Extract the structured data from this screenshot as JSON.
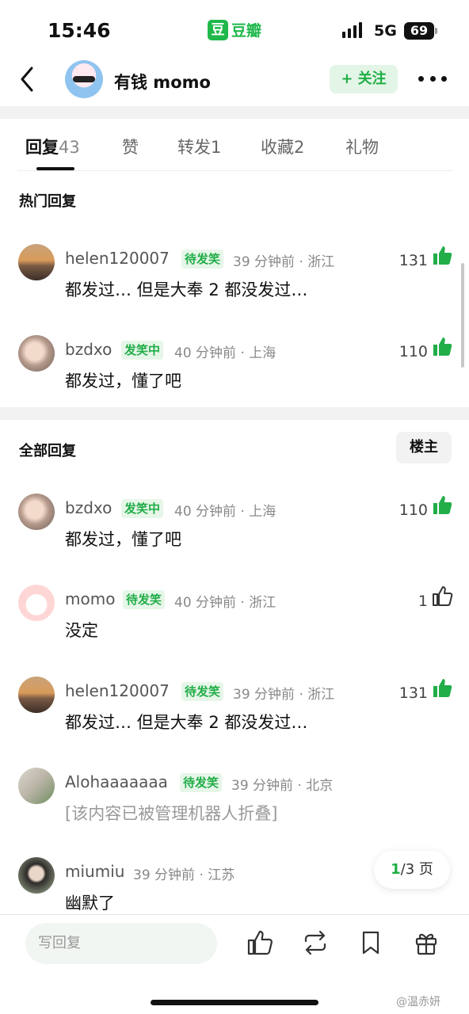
{
  "status_bar": {
    "time": "15:46",
    "app_icon_char": "豆",
    "app_name": "豆瓣",
    "network": "5G",
    "battery": "69"
  },
  "header": {
    "username": "有钱 momo",
    "follow_label": "+ 关注"
  },
  "tabs": [
    {
      "label": "回复",
      "count": "43",
      "active": true
    },
    {
      "label": "赞",
      "count": ""
    },
    {
      "label": "转发",
      "count": "1"
    },
    {
      "label": "收藏",
      "count": "2"
    },
    {
      "label": "礼物",
      "count": ""
    }
  ],
  "hot_section": {
    "title": "热门回复",
    "comments": [
      {
        "user": "helen120007",
        "badge": "待发笑",
        "meta": "39 分钟前 · 浙江",
        "text": "都发过… 但是大奉 2 都没发过…",
        "likes": "131",
        "liked": true
      },
      {
        "user": "bzdxo",
        "badge": "发笑中",
        "meta": "40 分钟前 · 上海",
        "text": "都发过，懂了吧",
        "likes": "110",
        "liked": true
      }
    ]
  },
  "all_section": {
    "title": "全部回复",
    "owner_filter": "楼主",
    "comments": [
      {
        "user": "bzdxo",
        "badge": "发笑中",
        "meta": "40 分钟前 · 上海",
        "text": "都发过，懂了吧",
        "likes": "110",
        "liked": true
      },
      {
        "user": "momo",
        "badge": "待发笑",
        "meta": "40 分钟前 · 浙江",
        "text": "没定",
        "likes": "1",
        "liked": false
      },
      {
        "user": "helen120007",
        "badge": "待发笑",
        "meta": "39 分钟前 · 浙江",
        "text": "都发过… 但是大奉 2 都没发过…",
        "likes": "131",
        "liked": true
      },
      {
        "user": "Alohaaaaaaa",
        "badge": "待发笑",
        "meta": "39 分钟前 · 北京",
        "text": "[该内容已被管理机器人折叠]",
        "likes": "",
        "liked": false
      },
      {
        "user": "miumiu",
        "badge": "",
        "meta": "39 分钟前 · 江苏",
        "text": "幽默了",
        "likes": "",
        "liked": false
      }
    ]
  },
  "pager": {
    "current": "1",
    "total": "/3 页"
  },
  "bottom_bar": {
    "reply_placeholder": "写回复",
    "icons": [
      "thumb-up-icon",
      "repost-icon",
      "bookmark-icon",
      "gift-icon"
    ]
  },
  "watermark": "@温赤妍",
  "colors": {
    "accent": "#1fae46",
    "badge_bg": "#e6f6e8"
  }
}
